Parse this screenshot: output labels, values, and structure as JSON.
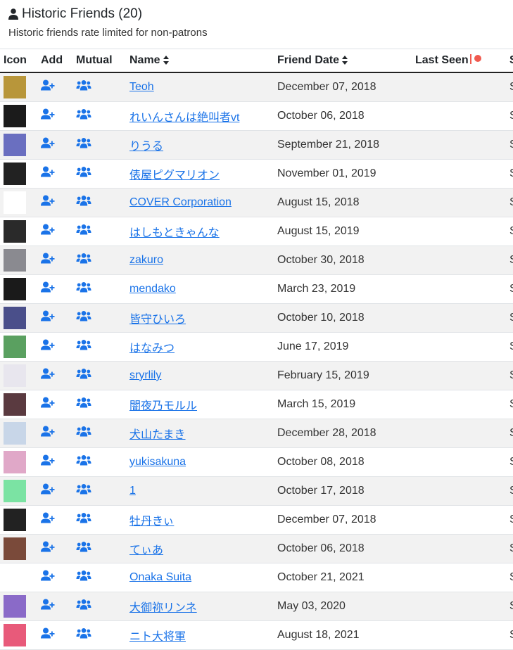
{
  "header": {
    "title": "Historic Friends (20)",
    "subtitle": "Historic friends rate limited for non-patrons"
  },
  "columns": {
    "icon": "Icon",
    "add": "Add",
    "mutual": "Mutual",
    "name": "Name",
    "friend_date": "Friend Date",
    "last_seen": "Last Seen",
    "status": "S"
  },
  "icons": {
    "header": "user-icon",
    "add": "user-plus-icon",
    "mutual": "users-icon",
    "sort": "sort-icon"
  },
  "colors": {
    "link": "#1a73e8",
    "action_icon": "#1a73e8",
    "last_seen_dot": "#f05a4f",
    "row_stripe": "#f2f2f2"
  },
  "friends": [
    {
      "name": "Teoh",
      "date": "December 07, 2018",
      "status": "S",
      "avatar": "#b8963a"
    },
    {
      "name": "れいんさんは絶叫者vt",
      "date": "October 06, 2018",
      "status": "S",
      "avatar": "#1b1b1b"
    },
    {
      "name": "りうる",
      "date": "September 21, 2018",
      "status": "S",
      "avatar": "#6a6fc0"
    },
    {
      "name": "俵屋ピグマリオン",
      "date": "November 01, 2019",
      "status": "S",
      "avatar": "#222222"
    },
    {
      "name": "COVER Corporation",
      "date": "August 15, 2018",
      "status": "S",
      "avatar": "#ffffff"
    },
    {
      "name": "はしもときゃんな",
      "date": "August 15, 2019",
      "status": "S",
      "avatar": "#2a2a2a"
    },
    {
      "name": "zakuro",
      "date": "October 30, 2018",
      "status": "S",
      "avatar": "#8a8a90"
    },
    {
      "name": "mendako",
      "date": "March 23, 2019",
      "status": "S",
      "avatar": "#1a1a1a"
    },
    {
      "name": "皆守ひいろ",
      "date": "October 10, 2018",
      "status": "S",
      "avatar": "#4a4f8a"
    },
    {
      "name": "はなみつ",
      "date": "June 17, 2019",
      "status": "S",
      "avatar": "#5aa060"
    },
    {
      "name": "sryrlily",
      "date": "February 15, 2019",
      "status": "S",
      "avatar": "#e8e6ee"
    },
    {
      "name": "闇夜乃モルル",
      "date": "March 15, 2019",
      "status": "S",
      "avatar": "#5a3a40"
    },
    {
      "name": "犬山たまき",
      "date": "December 28, 2018",
      "status": "S",
      "avatar": "#c8d6e8"
    },
    {
      "name": "yukisakuna",
      "date": "October 08, 2018",
      "status": "S",
      "avatar": "#e0a8c8"
    },
    {
      "name": "1",
      "date": "October 17, 2018",
      "status": "S",
      "avatar": "#7be3a3"
    },
    {
      "name": "牡丹きぃ",
      "date": "December 07, 2018",
      "status": "S",
      "avatar": "#222222"
    },
    {
      "name": "てぃあ",
      "date": "October 06, 2018",
      "status": "S",
      "avatar": "#7a4a3a"
    },
    {
      "name": "Onaka Suita",
      "date": "October 21, 2021",
      "status": "S",
      "avatar": "#ffffff"
    },
    {
      "name": "大御祢リンネ",
      "date": "May 03, 2020",
      "status": "S",
      "avatar": "#8a6ac8"
    },
    {
      "name": "ニト大将軍",
      "date": "August 18, 2021",
      "status": "S",
      "avatar": "#e85a7a"
    }
  ]
}
